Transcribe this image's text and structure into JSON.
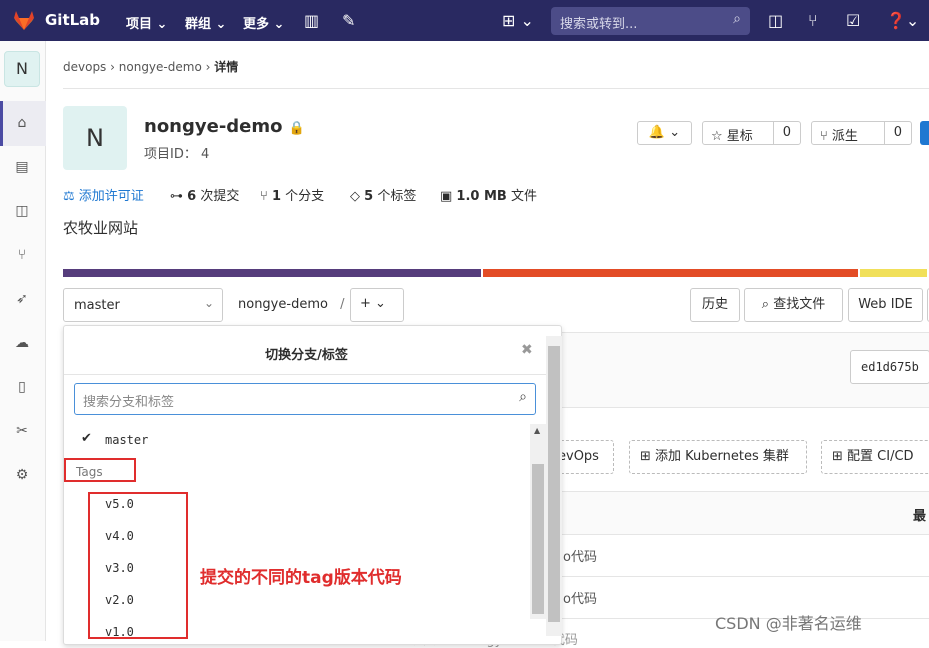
{
  "topbar": {
    "brand": "GitLab",
    "nav": [
      "项目 ⌄",
      "群组 ⌄",
      "更多 ⌄"
    ],
    "search_placeholder": "搜索或转到...",
    "bg_color": "#292961"
  },
  "sidebar": {
    "avatar_letter": "N",
    "icons": [
      "home-icon",
      "file-icon",
      "issues-icon",
      "merge-request-icon",
      "rocket-icon",
      "operations-icon",
      "package-icon",
      "snippets-icon",
      "settings-icon"
    ]
  },
  "breadcrumb": {
    "items": [
      "devops",
      "nongye-demo"
    ],
    "current": "详情"
  },
  "project": {
    "avatar_letter": "N",
    "name": "nongye-demo",
    "id_label": "项目ID： 4",
    "notify_label": "🔔 ⌄",
    "star_label": "☆ 星标",
    "star_count": "0",
    "fork_label": "⑂ 派生",
    "fork_count": "0",
    "description": "农牧业网站"
  },
  "stats": {
    "license": "添加许可证",
    "commits_num": "6",
    "commits_label": "次提交",
    "branches_num": "1",
    "branches_label": "个分支",
    "tags_num": "5",
    "tags_label": "个标签",
    "size_num": "1.0 MB",
    "size_label": "文件"
  },
  "language_bar": [
    {
      "color": "#563d7c",
      "fraction": 0.485
    },
    {
      "color": "#e34c26",
      "fraction": 0.435
    },
    {
      "color": "#f1e05a",
      "fraction": 0.08
    }
  ],
  "repo": {
    "branch": "master",
    "path": "nongye-demo",
    "path_sep": "/",
    "plus_label": "+ ⌄",
    "history": "历史",
    "find_file": "查找文件",
    "web_ide": "Web IDE",
    "commit_sha": "ed1d675b",
    "devops_btn": "evOps",
    "k8s_btn": "添加 Kubernetes 集群",
    "cicd_btn": "配置 CI/CD",
    "col_last": "最",
    "row1": "o代码",
    "row2": "o代码",
    "row3": "提交的的nongye-demo代码"
  },
  "dropdown": {
    "title": "切换分支/标签",
    "search_placeholder": "搜索分支和标签",
    "branches": [
      "master"
    ],
    "tags_header": "Tags",
    "tags": [
      "v5.0",
      "v4.0",
      "v3.0",
      "v2.0",
      "v1.0"
    ]
  },
  "annotation": "提交的不同的tag版本代码",
  "watermark": "CSDN @非著名运维"
}
